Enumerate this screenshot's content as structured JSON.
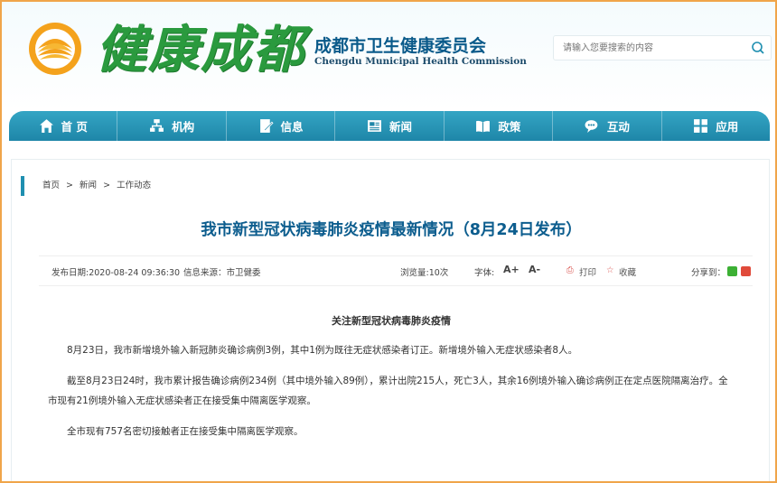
{
  "header": {
    "logo_text": "健康成都",
    "org_name_cn": "成都市卫生健康委员会",
    "org_name_en": "Chengdu Municipal Health Commission",
    "search": {
      "placeholder": "请输入您要搜索的内容",
      "icon": "search-icon"
    }
  },
  "nav": {
    "items": [
      {
        "label": "首 页",
        "icon": "home-icon"
      },
      {
        "label": "机构",
        "icon": "org-icon"
      },
      {
        "label": "信息",
        "icon": "edit-icon"
      },
      {
        "label": "新闻",
        "icon": "news-icon"
      },
      {
        "label": "政策",
        "icon": "book-icon"
      },
      {
        "label": "互动",
        "icon": "chat-icon"
      },
      {
        "label": "应用",
        "icon": "grid-icon"
      }
    ]
  },
  "breadcrumb": {
    "home": "首页",
    "sep1": ">",
    "news": "新闻",
    "sep2": ">",
    "current": "工作动态"
  },
  "article": {
    "title": "我市新型冠状病毒肺炎疫情最新情况（8月24日发布）",
    "meta": {
      "date": "发布日期:2020-08-24 09:36:30",
      "source": "信息来源：市卫健委",
      "views": "浏览量:10次",
      "font_label": "字体:",
      "font_up": "A+",
      "font_down": "A-",
      "print": "打印",
      "favorite": "收藏",
      "share_label": "分享到："
    },
    "subheading": "关注新型冠状病毒肺炎疫情",
    "paragraphs": [
      "8月23日，我市新增境外输入新冠肺炎确诊病例3例，其中1例为既往无症状感染者订正。新增境外输入无症状感染者8人。",
      "截至8月23日24时，我市累计报告确诊病例234例（其中境外输入89例），累计出院215人，死亡3人，其余16例境外输入确诊病例正在定点医院隔离治疗。全市现有21例境外输入无症状感染者正在接受集中隔离医学观察。",
      "全市现有757名密切接触者正在接受集中隔离医学观察。"
    ]
  },
  "colors": {
    "frame": "#f0a54a",
    "nav": "#2596b8",
    "title": "#0c5d8e",
    "logo": "#2a9a3e"
  }
}
